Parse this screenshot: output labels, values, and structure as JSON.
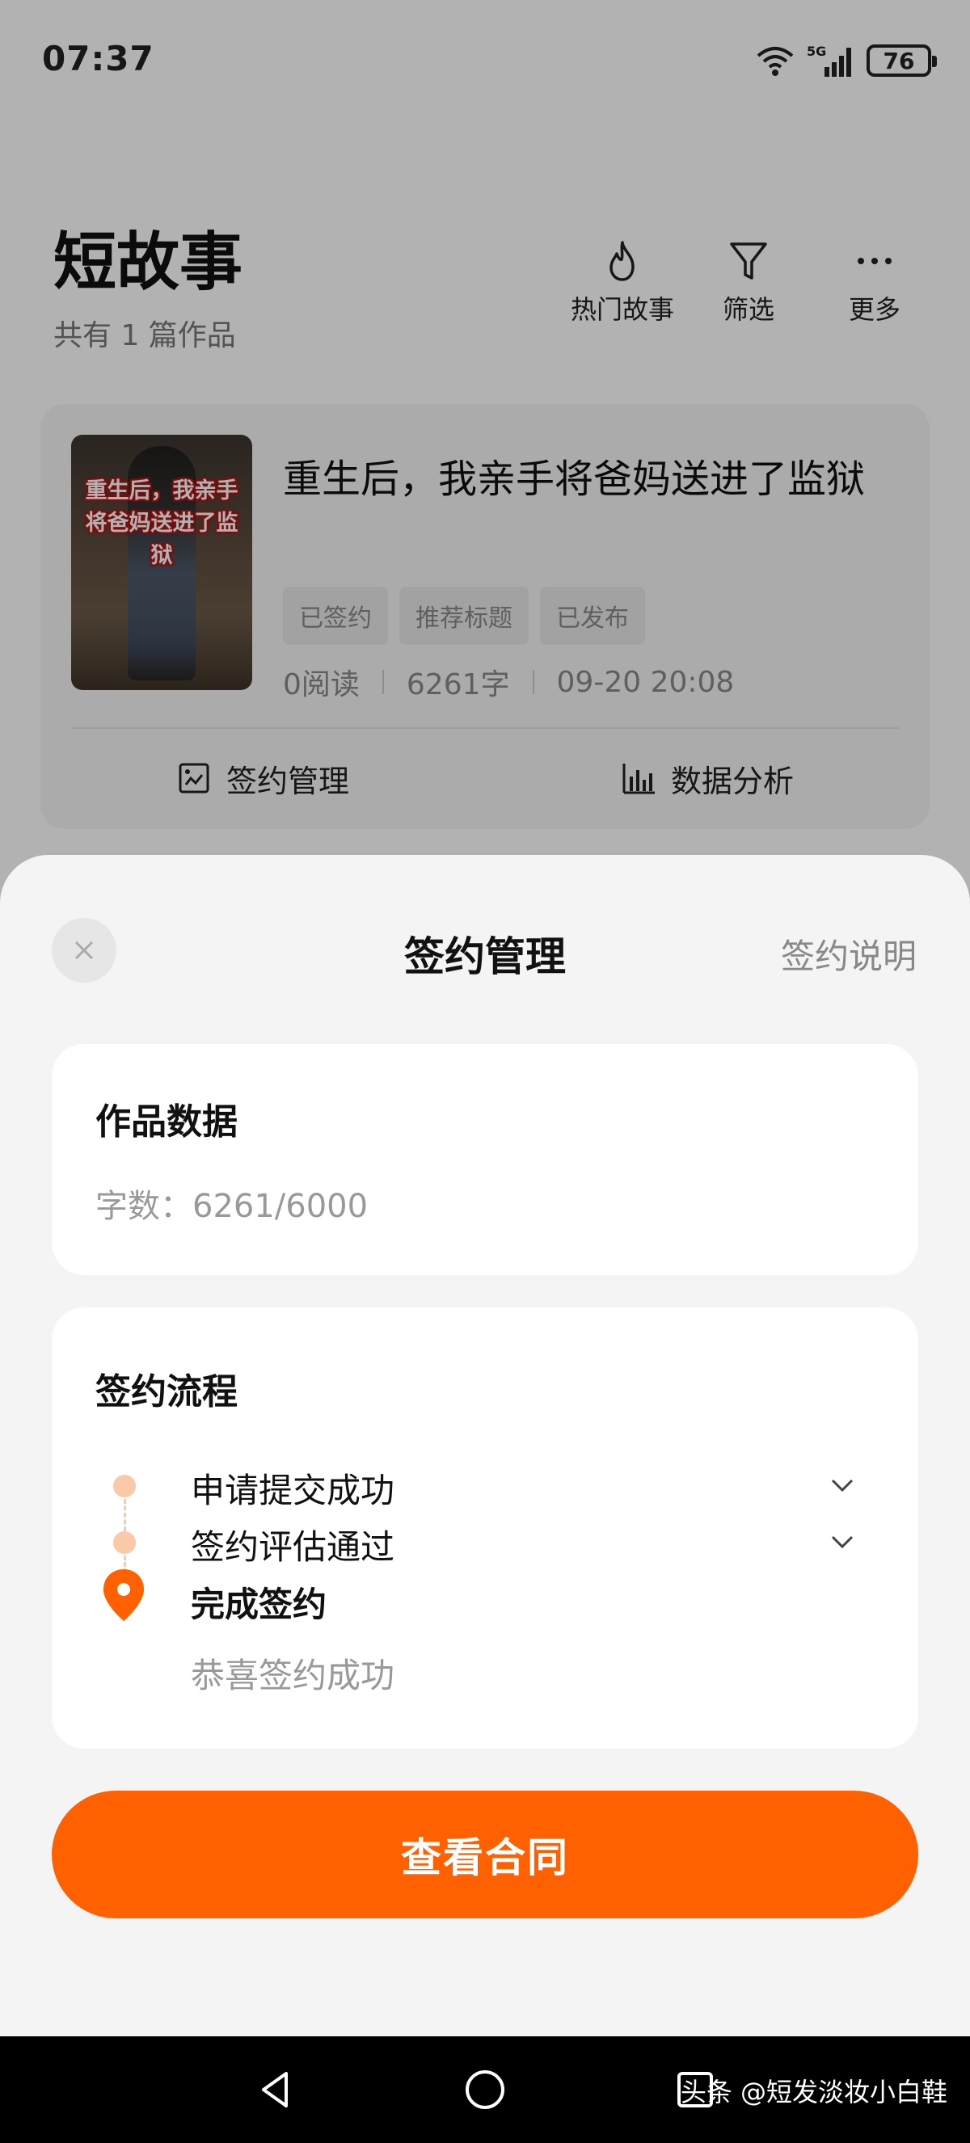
{
  "status_bar": {
    "time": "07:37",
    "network": "5G",
    "battery": "76"
  },
  "header": {
    "title": "短故事",
    "subtitle": "共有 1 篇作品",
    "actions": [
      {
        "label": "热门故事",
        "icon": "flame-icon"
      },
      {
        "label": "筛选",
        "icon": "filter-icon"
      },
      {
        "label": "更多",
        "icon": "more-icon"
      }
    ]
  },
  "work": {
    "cover_text": "重生后，我亲手将爸妈送进了监狱",
    "title": "重生后，我亲手将爸妈送进了监狱",
    "tags": [
      "已签约",
      "推荐标题",
      "已发布"
    ],
    "reads": "0阅读",
    "words": "6261字",
    "date": "09-20 20:08",
    "actions": [
      {
        "label": "签约管理",
        "icon": "contract-icon"
      },
      {
        "label": "数据分析",
        "icon": "bar-chart-icon"
      }
    ]
  },
  "sheet": {
    "title": "签约管理",
    "help_link": "签约说明",
    "data_panel": {
      "heading": "作品数据",
      "word_count": "字数：6261/6000"
    },
    "flow_panel": {
      "heading": "签约流程",
      "steps": [
        {
          "label": "申请提交成功",
          "state": "done"
        },
        {
          "label": "签约评估通过",
          "state": "done"
        },
        {
          "label": "完成签约",
          "state": "current"
        }
      ],
      "note": "恭喜签约成功"
    },
    "primary_button": "查看合同",
    "accent_color": "#ff6000"
  },
  "watermark": "头条 @短发淡妆小白鞋"
}
